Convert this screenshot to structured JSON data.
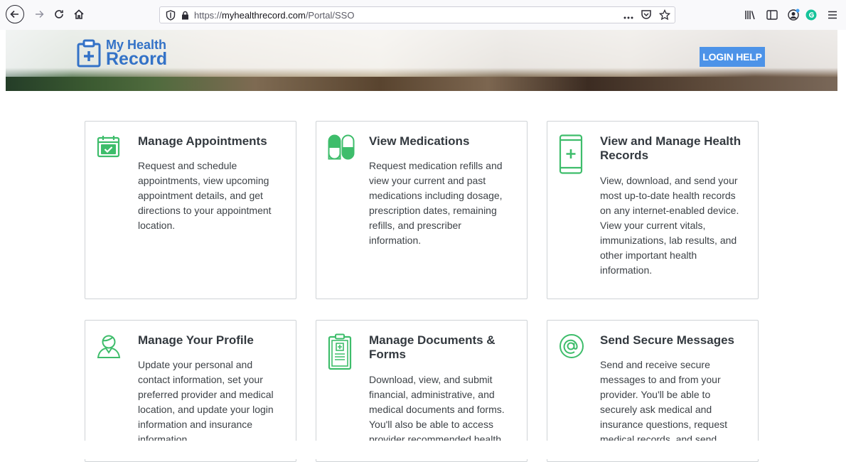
{
  "browser": {
    "url_prefix": "https://",
    "url_domain": "myhealthrecord.com",
    "url_path": "/Portal/SSO",
    "icons": [
      "back-arrow-icon",
      "forward-arrow-icon",
      "reload-icon",
      "home-icon",
      "shield-icon",
      "lock-icon",
      "more-icon",
      "pocket-icon",
      "bookmark-star-icon",
      "library-icon",
      "sidebar-icon",
      "account-icon",
      "extension-icon",
      "menu-icon"
    ]
  },
  "header": {
    "logo_line1": "My Health",
    "logo_line2": "Record",
    "login_help": "LOGIN HELP"
  },
  "colors": {
    "accent_green": "#3ebd6b",
    "brand_blue": "#3372c7",
    "button_blue": "#4d93e8"
  },
  "cards": [
    {
      "icon": "calendar-check-icon",
      "title": "Manage Appointments",
      "description": "Request and schedule appointments, view upcoming appointment details, and get directions to your appointment location."
    },
    {
      "icon": "pill-capsule-icon",
      "title": "View Medications",
      "description": "Request medication refills and view your current and past medications including dosage, prescription dates, remaining refills, and prescriber information."
    },
    {
      "icon": "mobile-health-record-icon",
      "title": "View and Manage Health Records",
      "description": "View, download, and send your most up-to-date health records on any internet-enabled device. View your current vitals, immunizations, lab results, and other important health information."
    },
    {
      "icon": "user-profile-icon",
      "title": "Manage Your Profile",
      "description": "Update your personal and contact information, set your preferred provider and medical location, and update your login information and insurance information."
    },
    {
      "icon": "clipboard-document-icon",
      "title": "Manage Documents & Forms",
      "description": "Download, view, and submit financial, administrative, and medical documents and forms. You'll also be able to access provider recommended health"
    },
    {
      "icon": "at-sign-icon",
      "title": "Send Secure Messages",
      "description": "Send and receive secure messages to and from your provider. You'll be able to securely ask medical and insurance questions, request medical records, and send"
    }
  ]
}
